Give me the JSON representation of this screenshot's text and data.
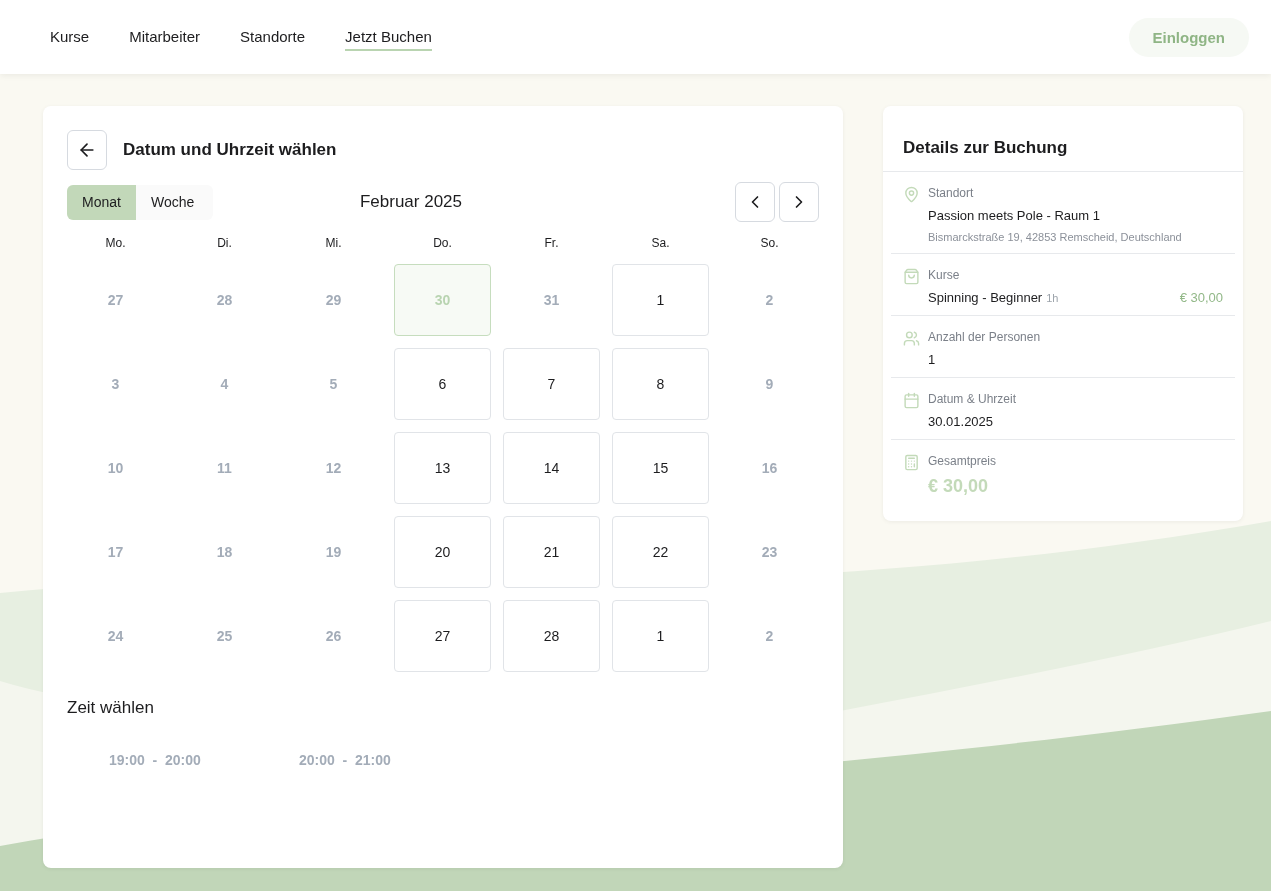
{
  "nav": {
    "items": [
      {
        "label": "Kurse",
        "selected": false
      },
      {
        "label": "Mitarbeiter",
        "selected": false
      },
      {
        "label": "Standorte",
        "selected": false
      },
      {
        "label": "Jetzt Buchen",
        "selected": true
      }
    ],
    "login": {
      "label": "Einloggen",
      "disabled": true
    }
  },
  "booking": {
    "title": "Datum und Uhrzeit wählen",
    "view_toggle": [
      {
        "label": "Monat",
        "selected": true
      },
      {
        "label": "Woche",
        "selected": false
      }
    ],
    "month": "Februar 2025",
    "weekdays": [
      "Mo.",
      "Di.",
      "Mi.",
      "Do.",
      "Fr.",
      "Sa.",
      "So."
    ],
    "days": [
      {
        "label": "27",
        "available": false,
        "selected": false
      },
      {
        "label": "28",
        "available": false,
        "selected": false
      },
      {
        "label": "29",
        "available": false,
        "selected": false
      },
      {
        "label": "30",
        "available": true,
        "selected": true
      },
      {
        "label": "31",
        "available": false,
        "selected": false
      },
      {
        "label": "1",
        "available": true,
        "selected": false
      },
      {
        "label": "2",
        "available": false,
        "selected": false
      },
      {
        "label": "3",
        "available": false,
        "selected": false
      },
      {
        "label": "4",
        "available": false,
        "selected": false
      },
      {
        "label": "5",
        "available": false,
        "selected": false
      },
      {
        "label": "6",
        "available": true,
        "selected": false
      },
      {
        "label": "7",
        "available": true,
        "selected": false
      },
      {
        "label": "8",
        "available": true,
        "selected": false
      },
      {
        "label": "9",
        "available": false,
        "selected": false
      },
      {
        "label": "10",
        "available": false,
        "selected": false
      },
      {
        "label": "11",
        "available": false,
        "selected": false
      },
      {
        "label": "12",
        "available": false,
        "selected": false
      },
      {
        "label": "13",
        "available": true,
        "selected": false
      },
      {
        "label": "14",
        "available": true,
        "selected": false
      },
      {
        "label": "15",
        "available": true,
        "selected": false
      },
      {
        "label": "16",
        "available": false,
        "selected": false
      },
      {
        "label": "17",
        "available": false,
        "selected": false
      },
      {
        "label": "18",
        "available": false,
        "selected": false
      },
      {
        "label": "19",
        "available": false,
        "selected": false
      },
      {
        "label": "20",
        "available": true,
        "selected": false
      },
      {
        "label": "21",
        "available": true,
        "selected": false
      },
      {
        "label": "22",
        "available": true,
        "selected": false
      },
      {
        "label": "23",
        "available": false,
        "selected": false
      },
      {
        "label": "24",
        "available": false,
        "selected": false
      },
      {
        "label": "25",
        "available": false,
        "selected": false
      },
      {
        "label": "26",
        "available": false,
        "selected": false
      },
      {
        "label": "27",
        "available": true,
        "selected": false
      },
      {
        "label": "28",
        "available": true,
        "selected": false
      },
      {
        "label": "1",
        "available": true,
        "selected": false
      },
      {
        "label": "2",
        "available": false,
        "selected": false
      }
    ],
    "time_title": "Zeit wählen",
    "time_slots": [
      {
        "start": "19:00",
        "separator": "-",
        "end": "20:00",
        "disabled": true
      },
      {
        "start": "20:00",
        "separator": "-",
        "end": "21:00",
        "disabled": true
      }
    ]
  },
  "details": {
    "title": "Details zur Buchung",
    "sections": [
      {
        "kind": "location",
        "label": "Standort",
        "value": "Passion meets Pole - Raum 1",
        "sub": "Bismarckstraße 19, 42853 Remscheid, Deutschland"
      },
      {
        "kind": "course",
        "label": "Kurse",
        "value": "Spinning - Beginner",
        "duration": "1h",
        "price": "€ 30,00"
      },
      {
        "kind": "persons",
        "label": "Anzahl der Personen",
        "value": "1"
      },
      {
        "kind": "date",
        "label": "Datum & Uhrzeit",
        "value": "30.01.2025"
      },
      {
        "kind": "total",
        "label": "Gesamtpreis",
        "price": "€ 30,00"
      }
    ]
  }
}
